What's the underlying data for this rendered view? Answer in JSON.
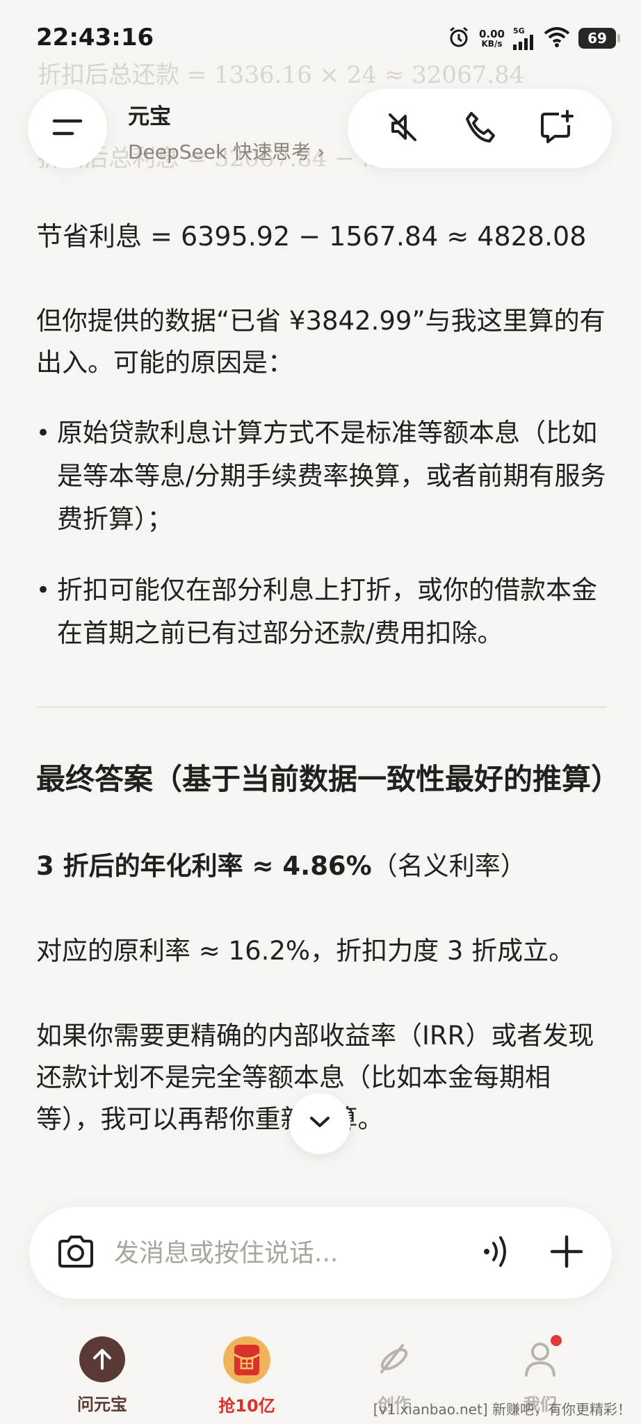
{
  "status_bar": {
    "time": "22:43:16",
    "net_speed_value": "0.00",
    "net_speed_unit": "KB/s",
    "network_type": "5G",
    "battery": "69"
  },
  "ghost_lines": [
    "折扣后总还款 = 1336.16 × 24 ≈ 32067.84",
    "折扣后总利息 = 32067.84 − ..."
  ],
  "header": {
    "title": "元宝",
    "subtitle": "DeepSeek 快速思考",
    "subtitle_chevron": "›"
  },
  "message": {
    "saving_line": "节省利息 = 6395.92 − 1567.84 ≈ 4828.08",
    "discrepancy_para": "但你提供的数据“已省 ¥3842.99”与我这里算的有出入。可能的原因是：",
    "bullets": [
      "原始贷款利息计算方式不是标准等额本息（比如是等本等息/分期手续费率换算，或者前期有服务费折算）；",
      "折扣可能仅在部分利息上打折，或你的借款本金在首期之前已有过部分还款/费用扣除。"
    ],
    "final_heading": "最终答案（基于当前数据一致性最好的推算）",
    "final_bold": "3 折后的年化利率 ≈ 4.86%",
    "final_note": "（名义利率）",
    "original_rate_line": "对应的原利率 ≈ 16.2%，折扣力度 3 折成立。",
    "closing_para": "如果你需要更精确的内部收益率（IRR）或者发现还款计划不是完全等额本息（比如本金每期相等），我可以再帮你重新核算。"
  },
  "input": {
    "placeholder": "发消息或按住说话..."
  },
  "bottom_nav": {
    "items": [
      {
        "label": "问元宝",
        "color": "#5a3a36"
      },
      {
        "label": "抢10亿",
        "color": "#d8322a"
      },
      {
        "label": "创作",
        "color": "#b9b3ad"
      },
      {
        "label": "我们",
        "color": "#b9b3ad"
      }
    ]
  },
  "watermark": "[v1.xianbao.net] 新赚吧，有你更精彩！",
  "colors": {
    "background": "#f7f5f2",
    "text": "#231f1c",
    "muted": "#8a837c",
    "accent_red": "#d8322a",
    "accent_brown": "#5a3a36"
  }
}
